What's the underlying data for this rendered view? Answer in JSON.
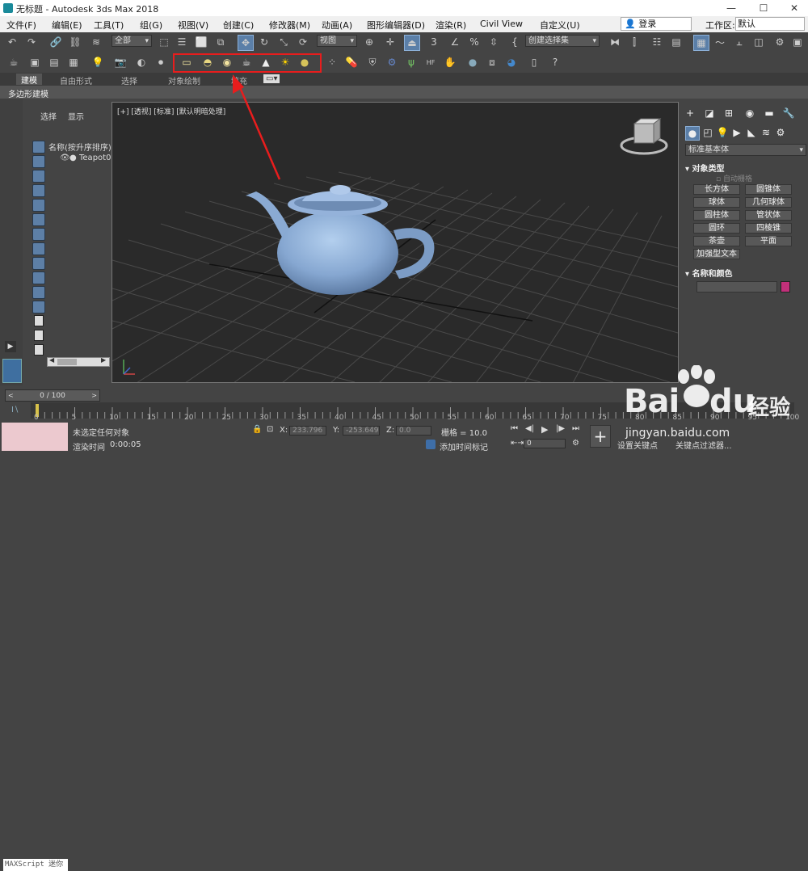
{
  "window": {
    "title": "无标题 - Autodesk 3ds Max 2018",
    "minimize": "—",
    "maximize": "☐",
    "close": "✕"
  },
  "menubar": {
    "items": [
      "文件(F)",
      "编辑(E)",
      "工具(T)",
      "组(G)",
      "视图(V)",
      "创建(C)",
      "修改器(M)",
      "动画(A)",
      "图形编辑器(D)",
      "渲染(R)",
      "Civil View",
      "自定义(U)"
    ],
    "login": "登录",
    "workspace_label": "工作区:",
    "workspace_value": "默认"
  },
  "toolbar": {
    "selection_filter": "全部",
    "ref_coord": "视图",
    "named_selection": "创建选择集",
    "percent_label": "%"
  },
  "ribbon": {
    "tabs": [
      "建模",
      "自由形式",
      "选择",
      "对象绘制",
      "填充"
    ],
    "sub": "多边形建模"
  },
  "scene_explorer": {
    "tab_select": "选择",
    "tab_display": "显示",
    "column_header": "名称(按升序排序)",
    "items": [
      "Teapot001"
    ]
  },
  "viewport": {
    "label": "[+] [透视] [标准] [默认明暗处理]"
  },
  "command_panel": {
    "category": "标准基本体",
    "object_type_title": "对象类型",
    "autogrid": "自动栅格",
    "buttons": [
      "长方体",
      "圆锥体",
      "球体",
      "几何球体",
      "圆柱体",
      "管状体",
      "圆环",
      "四棱锥",
      "茶壶",
      "平面"
    ],
    "extended_button": "加强型文本",
    "name_color_title": "名称和颜色",
    "object_color": "#c1307a"
  },
  "timeline": {
    "frame": "0 / 100",
    "ticks": [
      "0",
      "5",
      "10",
      "15",
      "20",
      "25",
      "30",
      "35",
      "40",
      "45",
      "50",
      "55",
      "60",
      "65",
      "70",
      "75",
      "80",
      "85",
      "90",
      "95",
      "100"
    ]
  },
  "status": {
    "maxscript": "MAXScript 迷你",
    "selection": "未选定任何对象",
    "render_time_label": "渲染时间",
    "render_time": "0:00:05",
    "x_label": "X:",
    "x_value": "233.796",
    "y_label": "Y:",
    "y_value": "-253.649",
    "z_label": "Z:",
    "z_value": "0.0",
    "grid": "栅格 = 10.0",
    "add_time_tag": "添加时间标记",
    "set_key": "设置关键点",
    "key_filters": "关键点过滤器...",
    "frame_spinner": "0"
  },
  "watermark": {
    "brand": "Bai",
    "brand2": "du",
    "suffix": "经验",
    "url": "jingyan.baidu.com"
  },
  "colors": {
    "highlight": "#e81d1d",
    "teapot": "#7f9fc8",
    "viewport_bg": "#2a2a2a"
  }
}
